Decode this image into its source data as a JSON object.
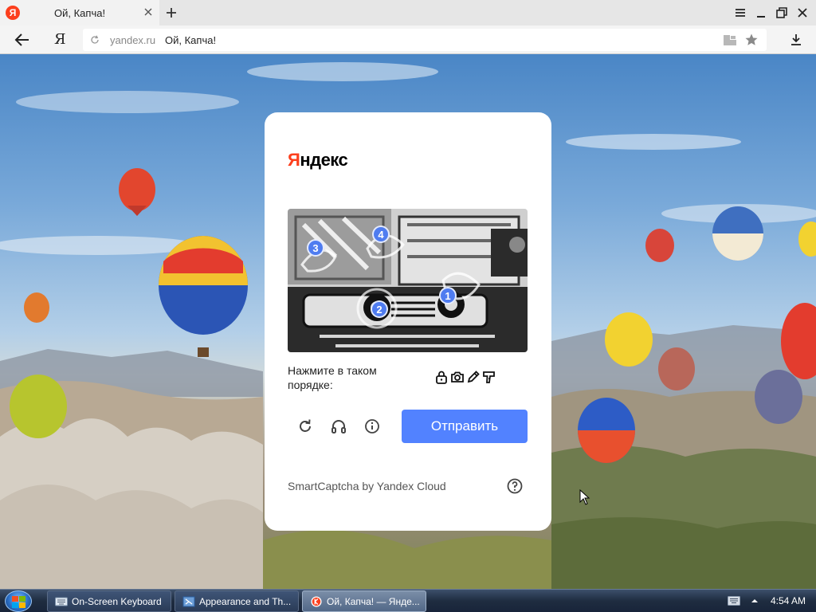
{
  "browser": {
    "tab_title": "Ой, Капча!",
    "favicon_letter": "Я",
    "url_host": "yandex.ru",
    "url_title": "Ой, Капча!",
    "logo_letter": "Я"
  },
  "captcha": {
    "brand_first": "Я",
    "brand_rest": "ндекс",
    "markers": [
      "1",
      "2",
      "3",
      "4"
    ],
    "instruction": "Нажмите в таком порядке:",
    "sequence_icons": [
      "lock-icon",
      "camera-icon",
      "pencil-icon",
      "hair-dryer-icon"
    ],
    "submit_label": "Отправить",
    "footer": "SmartCaptcha by Yandex Cloud"
  },
  "taskbar": {
    "items": [
      {
        "label": "On-Screen Keyboard",
        "icon": "keyboard-icon"
      },
      {
        "label": "Appearance and Th...",
        "icon": "control-panel-icon"
      },
      {
        "label": "Ой, Капча! — Янде...",
        "icon": "yandex-browser-icon"
      }
    ],
    "clock": "4:54 AM"
  },
  "colors": {
    "brand_red": "#fc3f1d",
    "submit_blue": "#5282ff",
    "marker_blue": "#4f7cf0"
  }
}
